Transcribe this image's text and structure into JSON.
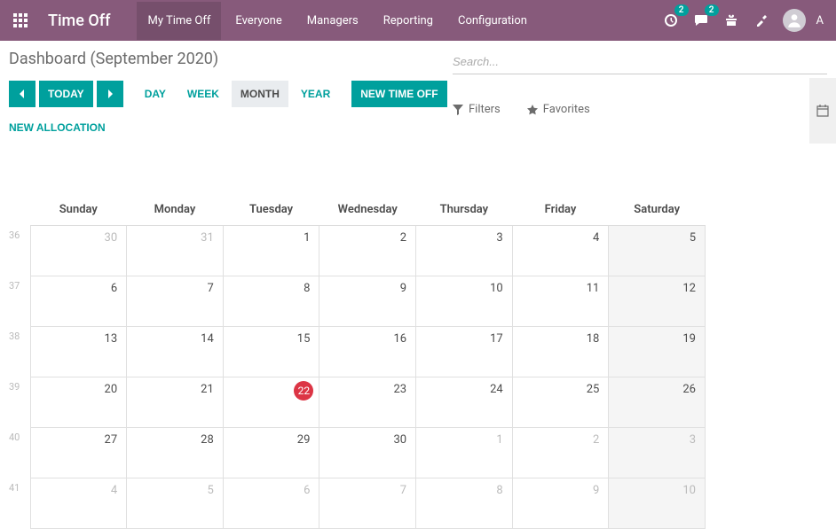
{
  "header": {
    "appTitle": "Time Off",
    "menu": [
      "My Time Off",
      "Everyone",
      "Managers",
      "Reporting",
      "Configuration"
    ],
    "activeMenu": 0,
    "activityBadge": "2",
    "messagesBadge": "2",
    "userInitial": "A"
  },
  "page": {
    "title": "Dashboard (September 2020)",
    "todayLabel": "TODAY",
    "views": [
      "DAY",
      "WEEK",
      "MONTH",
      "YEAR"
    ],
    "activeView": 2,
    "newTimeOff": "NEW TIME OFF",
    "newAllocation": "NEW ALLOCATION"
  },
  "search": {
    "placeholder": "Search...",
    "filtersLabel": "Filters",
    "favoritesLabel": "Favorites"
  },
  "calendar": {
    "dayHeaders": [
      "Sunday",
      "Monday",
      "Tuesday",
      "Wednesday",
      "Thursday",
      "Friday",
      "Saturday"
    ],
    "weeks": [
      {
        "num": "36",
        "days": [
          {
            "n": "30",
            "other": true
          },
          {
            "n": "31",
            "other": true
          },
          {
            "n": "1"
          },
          {
            "n": "2"
          },
          {
            "n": "3"
          },
          {
            "n": "4"
          },
          {
            "n": "5",
            "weekend": true
          }
        ]
      },
      {
        "num": "37",
        "days": [
          {
            "n": "6"
          },
          {
            "n": "7"
          },
          {
            "n": "8"
          },
          {
            "n": "9"
          },
          {
            "n": "10"
          },
          {
            "n": "11"
          },
          {
            "n": "12",
            "weekend": true
          }
        ]
      },
      {
        "num": "38",
        "days": [
          {
            "n": "13"
          },
          {
            "n": "14"
          },
          {
            "n": "15"
          },
          {
            "n": "16"
          },
          {
            "n": "17"
          },
          {
            "n": "18"
          },
          {
            "n": "19",
            "weekend": true
          }
        ]
      },
      {
        "num": "39",
        "days": [
          {
            "n": "20"
          },
          {
            "n": "21"
          },
          {
            "n": "22",
            "today": true
          },
          {
            "n": "23"
          },
          {
            "n": "24"
          },
          {
            "n": "25"
          },
          {
            "n": "26",
            "weekend": true
          }
        ]
      },
      {
        "num": "40",
        "days": [
          {
            "n": "27"
          },
          {
            "n": "28"
          },
          {
            "n": "29"
          },
          {
            "n": "30"
          },
          {
            "n": "1",
            "other": true
          },
          {
            "n": "2",
            "other": true
          },
          {
            "n": "3",
            "other": true,
            "weekend": true
          }
        ]
      },
      {
        "num": "41",
        "days": [
          {
            "n": "4",
            "other": true
          },
          {
            "n": "5",
            "other": true
          },
          {
            "n": "6",
            "other": true
          },
          {
            "n": "7",
            "other": true
          },
          {
            "n": "8",
            "other": true
          },
          {
            "n": "9",
            "other": true
          },
          {
            "n": "10",
            "other": true,
            "weekend": true
          }
        ]
      }
    ]
  }
}
